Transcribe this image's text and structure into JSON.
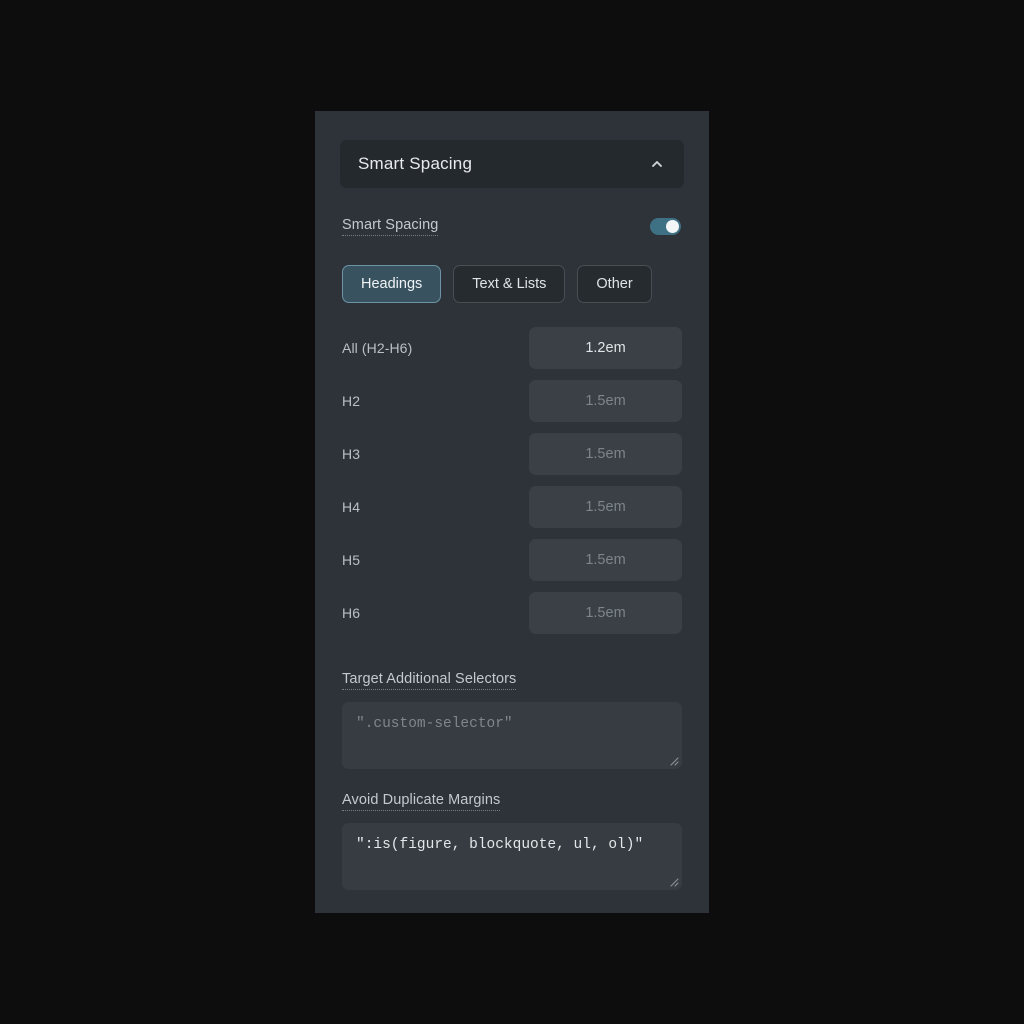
{
  "panel": {
    "section_header": {
      "title": "Smart Spacing",
      "collapse_icon": "chevron-up-icon"
    },
    "enable_toggle": {
      "label": "Smart Spacing",
      "state": "on"
    },
    "tabs": [
      {
        "label": "Headings",
        "active": true
      },
      {
        "label": "Text & Lists",
        "active": false
      },
      {
        "label": "Other",
        "active": false
      }
    ],
    "rows": [
      {
        "label": "All (H2-H6)",
        "value": "1.2em",
        "placeholder": "",
        "filled": true
      },
      {
        "label": "H2",
        "value": "",
        "placeholder": "1.5em",
        "filled": false
      },
      {
        "label": "H3",
        "value": "",
        "placeholder": "1.5em",
        "filled": false
      },
      {
        "label": "H4",
        "value": "",
        "placeholder": "1.5em",
        "filled": false
      },
      {
        "label": "H5",
        "value": "",
        "placeholder": "1.5em",
        "filled": false
      },
      {
        "label": "H6",
        "value": "",
        "placeholder": "1.5em",
        "filled": false
      }
    ],
    "target_selectors": {
      "label": "Target Additional Selectors",
      "value": "",
      "placeholder": "\".custom-selector\"",
      "resize_icon": "resize-grip-icon"
    },
    "avoid_duplicate_margins": {
      "label": "Avoid Duplicate Margins",
      "value": "\":is(figure, blockquote, ul, ol)\"",
      "placeholder": "",
      "resize_icon": "resize-grip-icon"
    }
  },
  "colors": {
    "page_background": "#0d0d0e",
    "panel_background": "#2d3338",
    "header_background": "#24292d",
    "input_background": "#3a4045",
    "textarea_background": "#363c41",
    "accent_toggle": "#3f7184",
    "accent_tab_active": "#39525f",
    "accent_tab_border": "#6e93a5",
    "text_primary": "#e8ebed",
    "text_secondary": "#b9c0c5",
    "text_muted": "#7d848a"
  }
}
